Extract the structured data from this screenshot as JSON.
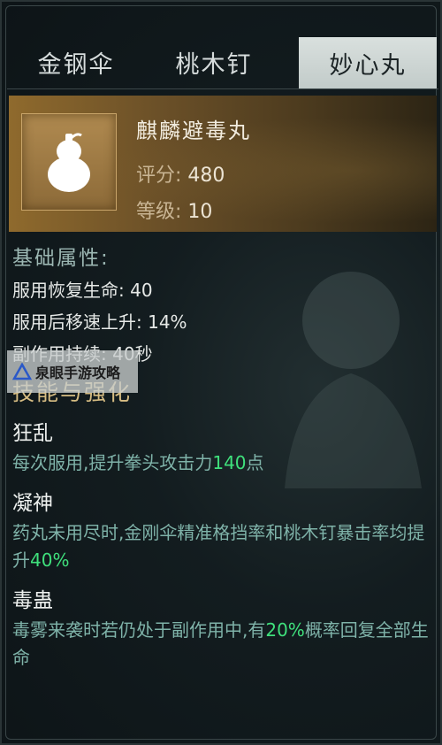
{
  "tabs": [
    {
      "label": "金钢伞",
      "active": false
    },
    {
      "label": "桃木钉",
      "active": false
    },
    {
      "label": "妙心丸",
      "active": true
    }
  ],
  "item": {
    "icon": "gourd-icon",
    "name": "麒麟避毒丸",
    "score_label": "评分:",
    "score_value": "480",
    "level_label": "等级:",
    "level_value": "10"
  },
  "base_attrs": {
    "title": "基础属性:",
    "lines": [
      {
        "label": "服用恢复生命:",
        "value": "40"
      },
      {
        "label": "服用后移速上升:",
        "value": "14%"
      },
      {
        "label": "副作用持续:",
        "value": "40秒"
      }
    ]
  },
  "skills": {
    "title": "技能与强化",
    "items": [
      {
        "name": "狂乱",
        "desc_before": "每次服用,提升拳头攻击力",
        "desc_highlight": "140",
        "desc_after": "点"
      },
      {
        "name": "凝神",
        "desc_before": "药丸未用尽时,金刚伞精准格挡率和桃木钉暴击率均提升",
        "desc_highlight": "40%",
        "desc_after": ""
      },
      {
        "name": "毒蛊",
        "desc_before": "毒雾来袭时若仍处于副作用中,有",
        "desc_highlight": "20%",
        "desc_after": "概率回复全部生命"
      }
    ]
  },
  "watermark": {
    "text": "泉眼手游攻略",
    "icon": "triangle-logo-icon"
  },
  "colors": {
    "highlight_green": "#3fe07c",
    "skill_desc": "#7fb3a9",
    "section_gold": "#d7bd83",
    "card_gold": "#8f6a2d"
  }
}
